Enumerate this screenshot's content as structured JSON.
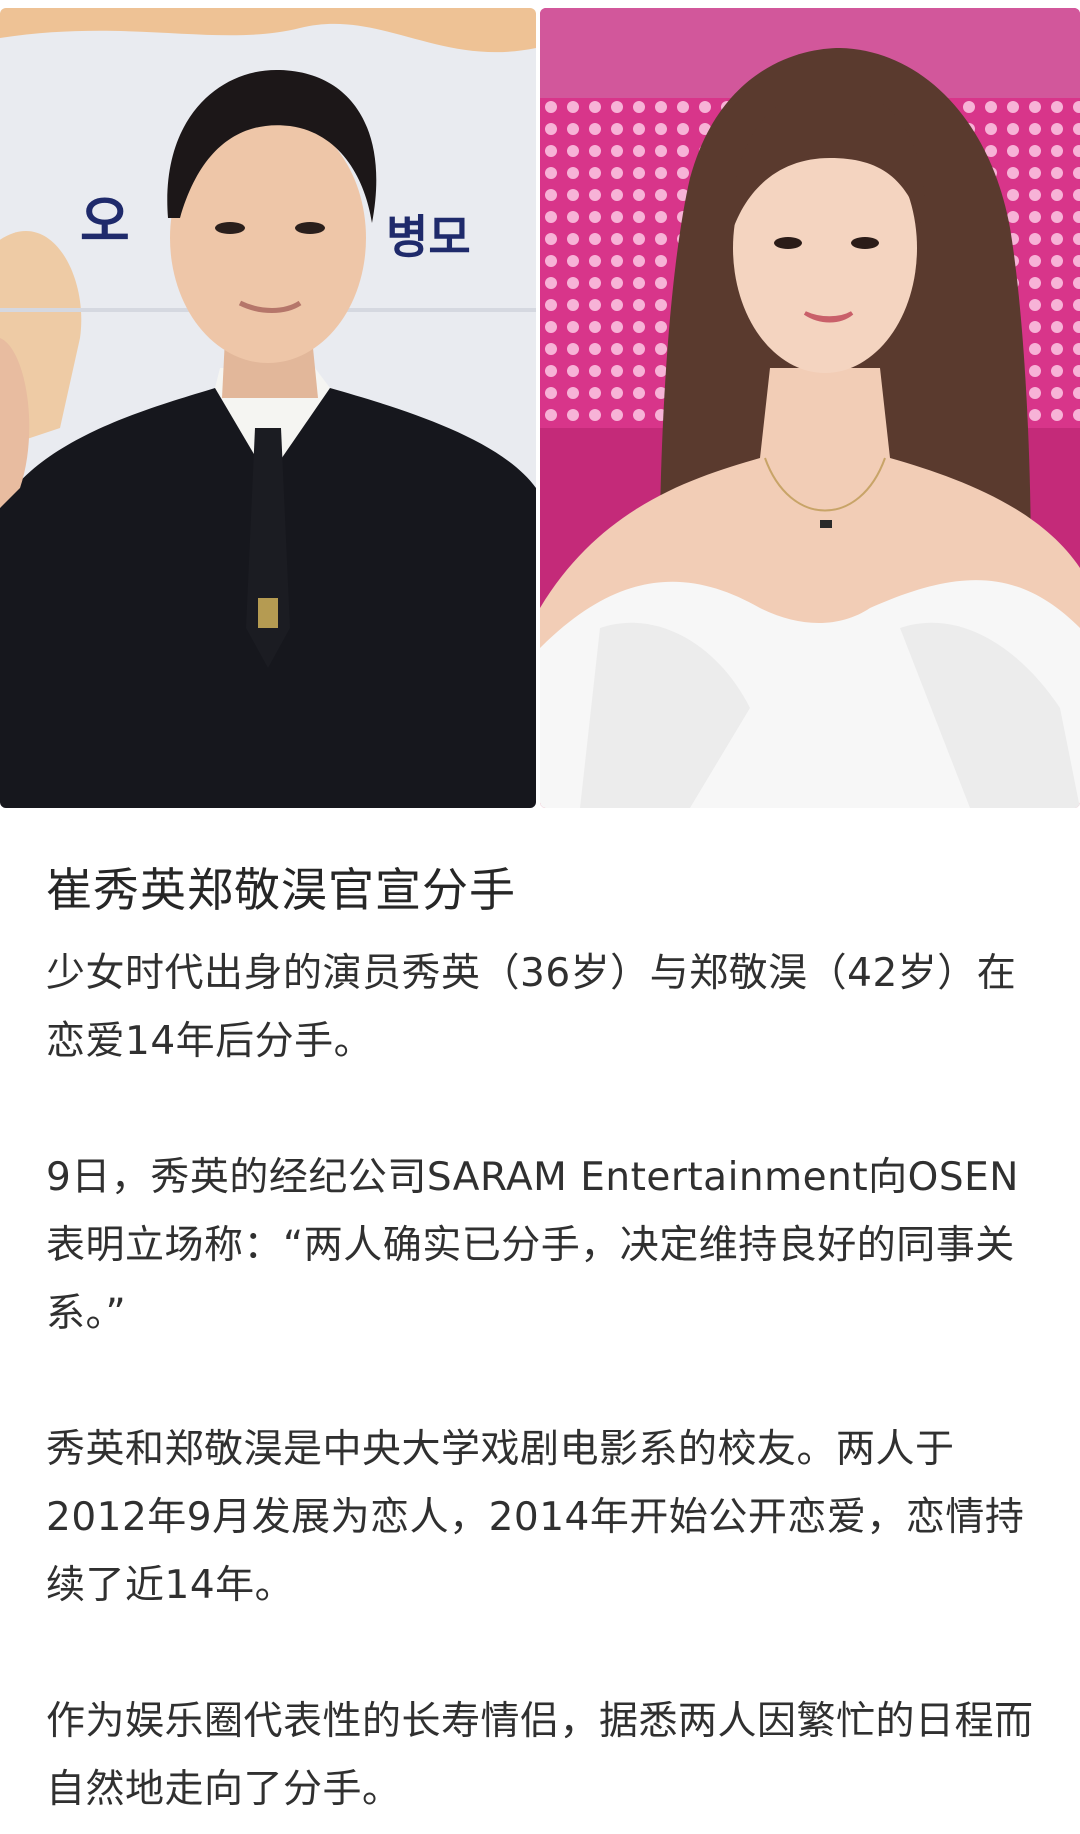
{
  "images": {
    "left_photo": {
      "alt_icon": "person-photo-icon",
      "poster_text": [
        "오",
        "병모"
      ]
    },
    "right_photo": {
      "alt_icon": "person-photo-icon"
    }
  },
  "article": {
    "headline": "崔秀英郑敬淏官宣分手",
    "paragraphs": [
      "少女时代出身的演员秀英（36岁）与郑敬淏（42岁）在恋爱14年后分手。",
      "9日，秀英的经纪公司SARAM Entertainment向OSEN表明立场称：“两人确实已分手，决定维持良好的同事关系。”",
      "秀英和郑敬淏是中央大学戏剧电影系的校友。两人于2012年9月发展为恋人，2014年开始公开恋爱，恋情持续了近14年。",
      "作为娱乐圈代表性的长寿情侣，据悉两人因繁忙的日程而自然地走向了分手。"
    ]
  },
  "colors": {
    "left_bg": "#e8eaef",
    "right_bg": "#e0368f",
    "suit": "#15161c",
    "dress": "#f7f7f7",
    "text": "#303030"
  }
}
